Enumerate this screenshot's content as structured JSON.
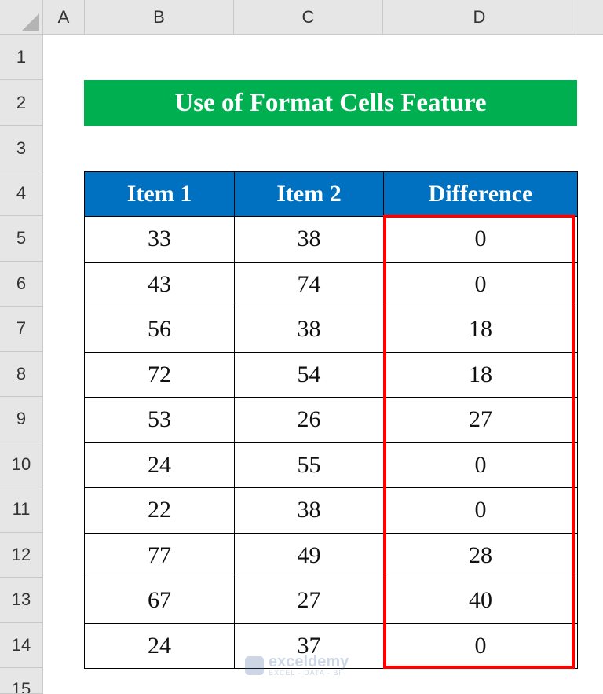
{
  "columns": [
    "A",
    "B",
    "C",
    "D"
  ],
  "rows": [
    "1",
    "2",
    "3",
    "4",
    "5",
    "6",
    "7",
    "8",
    "9",
    "10",
    "11",
    "12",
    "13",
    "14",
    "15"
  ],
  "title": "Use of Format Cells Feature",
  "table": {
    "headers": [
      "Item 1",
      "Item 2",
      "Difference"
    ],
    "rows": [
      [
        "33",
        "38",
        "0"
      ],
      [
        "43",
        "74",
        "0"
      ],
      [
        "56",
        "38",
        "18"
      ],
      [
        "72",
        "54",
        "18"
      ],
      [
        "53",
        "26",
        "27"
      ],
      [
        "24",
        "55",
        "0"
      ],
      [
        "22",
        "38",
        "0"
      ],
      [
        "77",
        "49",
        "28"
      ],
      [
        "67",
        "27",
        "40"
      ],
      [
        "24",
        "37",
        "0"
      ]
    ]
  },
  "watermark": {
    "name": "exceldemy",
    "tagline": "EXCEL · DATA · BI"
  },
  "colors": {
    "title_bg": "#00b050",
    "header_bg": "#0070c0",
    "highlight": "#ff0000"
  }
}
